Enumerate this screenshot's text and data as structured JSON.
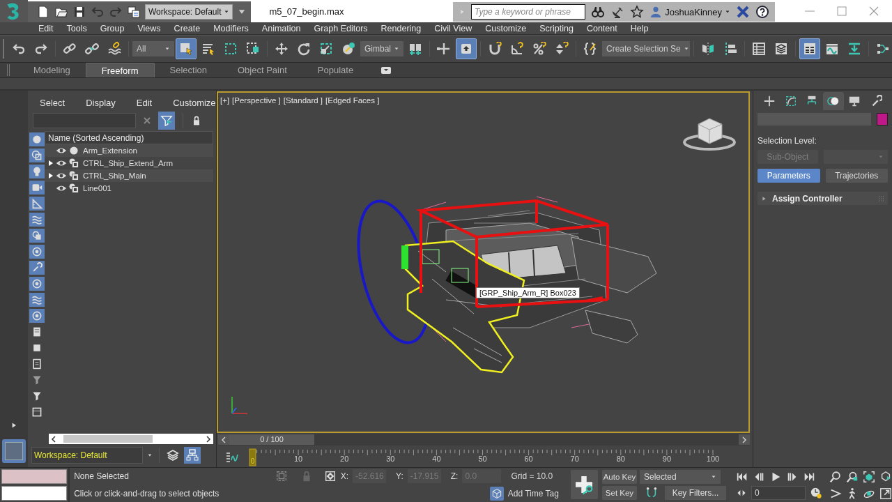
{
  "title_bar": {
    "workspace": "Workspace: Default",
    "file_name": "m5_07_begin.max",
    "search": {
      "placeholder": "Type a keyword or phrase"
    },
    "user": "JoshuaKinney"
  },
  "menu_bar": [
    "Edit",
    "Tools",
    "Group",
    "Views",
    "Create",
    "Modifiers",
    "Animation",
    "Graph Editors",
    "Rendering",
    "Civil View",
    "Customize",
    "Scripting",
    "Content",
    "Help"
  ],
  "main_toolbar": {
    "selection_filter": "All",
    "reference_coordinate_system": "Gimbal",
    "named_selection_set": "Create Selection Se",
    "select_object": {
      "on": true
    },
    "keyboard_override": {
      "on": true
    },
    "ribbon_toggle": {
      "on": true
    }
  },
  "ribbon_tabs": [
    {
      "label": "Modeling",
      "selected": false
    },
    {
      "label": "Freeform",
      "selected": true
    },
    {
      "label": "Selection",
      "selected": false
    },
    {
      "label": "Object Paint",
      "selected": false
    },
    {
      "label": "Populate",
      "selected": false
    }
  ],
  "scene_explorer": {
    "menu": [
      "Select",
      "Display",
      "Edit",
      "Customize"
    ],
    "filter_toggle": {
      "on": true
    },
    "column_header": "Name (Sorted Ascending)",
    "filters": [
      {
        "on": true
      },
      {
        "on": true
      },
      {
        "on": true
      },
      {
        "on": true
      },
      {
        "on": true
      },
      {
        "on": true
      },
      {
        "on": true
      },
      {
        "on": true
      },
      {
        "on": true
      },
      {
        "on": true
      },
      {
        "on": true
      },
      {
        "on": true
      },
      {
        "on": false
      },
      {
        "on": false
      },
      {
        "on": false
      },
      {
        "on": false
      },
      {
        "on": false
      },
      {
        "on": false
      }
    ],
    "items": [
      {
        "name": "Arm_Extension",
        "kind": "geometry",
        "has_children": false
      },
      {
        "name": "CTRL_Ship_Extend_Arm",
        "kind": "helper",
        "has_children": true
      },
      {
        "name": "CTRL_Ship_Main",
        "kind": "helper",
        "has_children": true
      },
      {
        "name": "Line001",
        "kind": "helper",
        "has_children": false
      }
    ],
    "workspace": "Workspace: Default",
    "hierarchy_mode": {
      "on": true
    }
  },
  "viewport": {
    "labels": [
      "[+]",
      "[Perspective ]",
      "[Standard ]",
      "[Edged Faces ]"
    ],
    "active": true,
    "tooltip": "[GRP_Ship_Arm_R] Box023"
  },
  "command_panel": {
    "tabs": [
      {
        "selected": false
      },
      {
        "selected": false
      },
      {
        "selected": false
      },
      {
        "selected": true
      },
      {
        "selected": false
      },
      {
        "selected": false
      }
    ],
    "selection_level_label": "Selection Level:",
    "sub_object": {
      "label": "Sub-Object",
      "disabled": true
    },
    "mode_buttons": [
      {
        "label": "Parameters",
        "selected": true
      },
      {
        "label": "Trajectories",
        "selected": false
      }
    ],
    "rollouts": [
      {
        "title": "Assign Controller",
        "expanded": false
      }
    ]
  },
  "time_slider": {
    "frame_label": "0 / 100",
    "level": 0
  },
  "track_bar": {
    "current_frame": "0",
    "ticks": [
      "10",
      "20",
      "30",
      "40",
      "50",
      "60",
      "70",
      "80",
      "90",
      "100"
    ]
  },
  "status": {
    "selection": "None Selected",
    "prompt": "Click or click-and-drag to select objects",
    "coordinates": [
      {
        "label": "X:",
        "value": "-52.616"
      },
      {
        "label": "Y:",
        "value": "-17.915"
      },
      {
        "label": "Z:",
        "value": "0.0"
      }
    ],
    "grid": "Grid = 10.0",
    "time_tag": "Add Time Tag",
    "auto_key": {
      "label": "Auto Key",
      "on": false
    },
    "set_key": "Set Key",
    "key_mode": "Selected",
    "key_filters": "Key Filters...",
    "current_frame": "0"
  }
}
